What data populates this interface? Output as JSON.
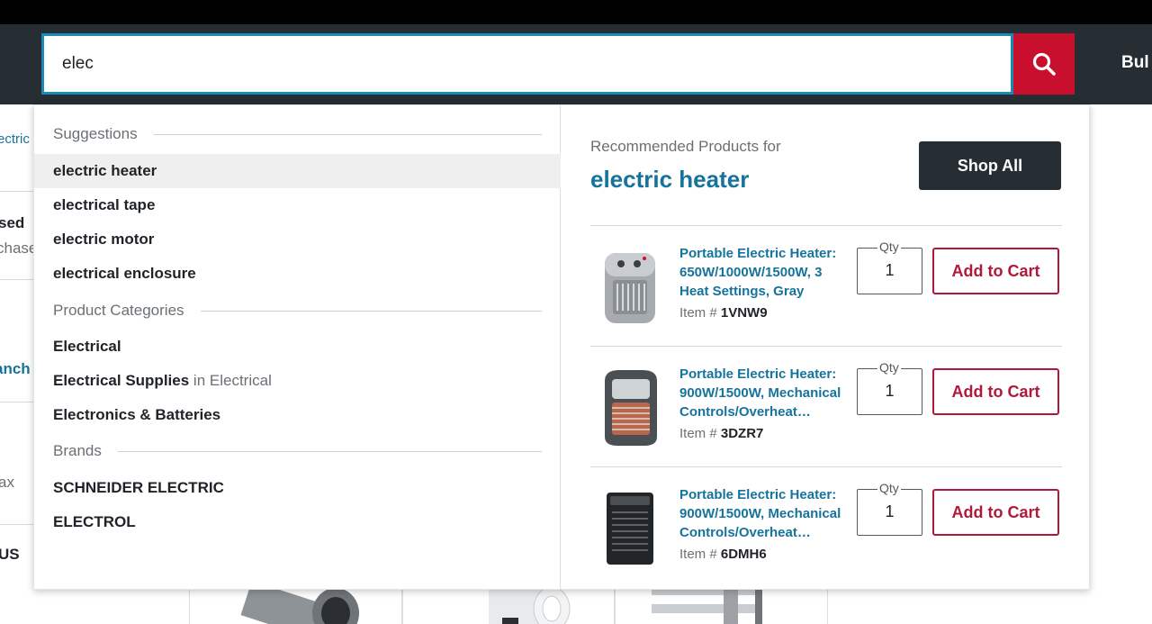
{
  "header": {
    "search_value": "elec",
    "search_icon": "search-icon",
    "right_link_partial": "Bul"
  },
  "background": {
    "left_fragments": [
      "ectric",
      "sed",
      "chase",
      "anch",
      "ax",
      "US"
    ]
  },
  "suggestions": {
    "heading": "Suggestions",
    "items": [
      "electric heater",
      "electrical tape",
      "electric motor",
      "electrical enclosure"
    ]
  },
  "categories": {
    "heading": "Product Categories",
    "items": [
      {
        "name": "Electrical",
        "context": ""
      },
      {
        "name": "Electrical Supplies",
        "context": "in Electrical"
      },
      {
        "name": "Electronics & Batteries",
        "context": ""
      }
    ]
  },
  "brands": {
    "heading": "Brands",
    "items": [
      "SCHNEIDER ELECTRIC",
      "ELECTROL"
    ]
  },
  "recommended": {
    "label": "Recommended Products for",
    "term": "electric heater",
    "shop_all": "Shop All",
    "products": [
      {
        "title": "Portable Electric Heater: 650W/1000W/1500W, 3 Heat Settings, Gray",
        "item_prefix": "Item #",
        "item_no": "1VNW9",
        "qty_label": "Qty",
        "qty": "1",
        "cta": "Add to Cart",
        "icon": "gray-space-heater-image"
      },
      {
        "title": "Portable Electric Heater: 900W/1500W, Mechanical Controls/Overheat…",
        "item_prefix": "Item #",
        "item_no": "3DZR7",
        "qty_label": "Qty",
        "qty": "1",
        "cta": "Add to Cart",
        "icon": "dark-space-heater-image"
      },
      {
        "title": "Portable Electric Heater: 900W/1500W, Mechanical Controls/Overheat…",
        "item_prefix": "Item #",
        "item_no": "6DMH6",
        "qty_label": "Qty",
        "qty": "1",
        "cta": "Add to Cart",
        "icon": "black-tower-heater-image"
      }
    ]
  },
  "colors": {
    "header_bg": "#262d33",
    "search_accent": "#c8102e",
    "link": "#16739c",
    "cta_border": "#b0193a"
  }
}
